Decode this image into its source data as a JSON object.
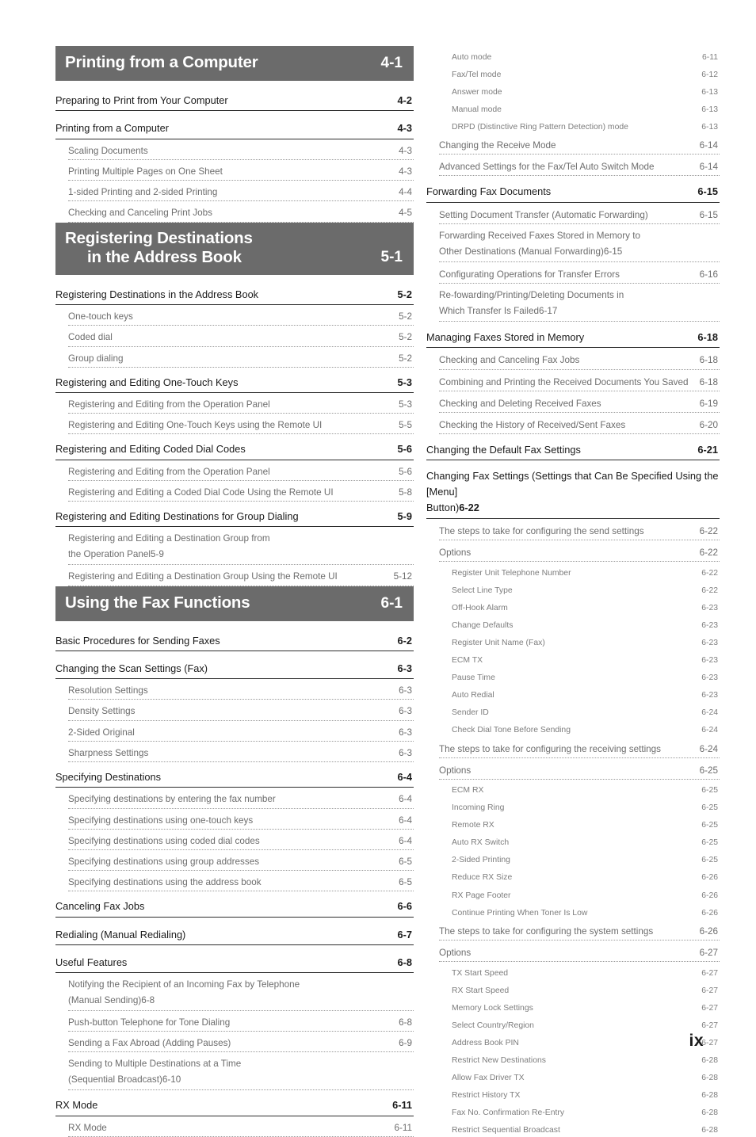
{
  "document": {
    "folio": "ix",
    "type": "table-of-contents"
  },
  "colors": {
    "chapter_bar_bg": "#6b6b6b",
    "chapter_bar_text": "#ffffff",
    "level1_text": "#1a1a1a",
    "level2_text": "#6d6d6d",
    "level3_text": "#7d7d7d",
    "level1_rule": "#2b2b2b",
    "level2_leader": "#9a9a9a"
  },
  "left_column": {
    "blocks": [
      {
        "kind": "chapter",
        "title_line1": "Printing from a Computer",
        "title_line2": "",
        "number": "4-1"
      },
      {
        "kind": "l1",
        "title": "Preparing to Print from Your Computer",
        "page": "4-2"
      },
      {
        "kind": "l1",
        "title": "Printing from a Computer",
        "page": "4-3"
      },
      {
        "kind": "l2",
        "title": "Scaling Documents",
        "page": "4-3"
      },
      {
        "kind": "l2",
        "title": "Printing Multiple Pages on One Sheet",
        "page": "4-3"
      },
      {
        "kind": "l2",
        "title": "1-sided Printing and 2-sided Printing",
        "page": "4-4"
      },
      {
        "kind": "l2",
        "title": "Checking and Canceling Print Jobs",
        "page": "4-5"
      },
      {
        "kind": "chapter",
        "title_line1": "Registering Destinations",
        "title_line2": "in the Address Book",
        "number": "5-1"
      },
      {
        "kind": "l1",
        "title": "Registering Destinations in the Address Book",
        "page": "5-2"
      },
      {
        "kind": "l2",
        "title": "One-touch keys",
        "page": "5-2"
      },
      {
        "kind": "l2",
        "title": "Coded dial",
        "page": "5-2"
      },
      {
        "kind": "l2",
        "title": "Group dialing",
        "page": "5-2"
      },
      {
        "kind": "l1",
        "title": "Registering and Editing One-Touch Keys",
        "page": "5-3"
      },
      {
        "kind": "l2",
        "title": "Registering and Editing from the Operation Panel",
        "page": "5-3"
      },
      {
        "kind": "l2",
        "title": "Registering and Editing One-Touch Keys using the Remote UI",
        "page": "5-5"
      },
      {
        "kind": "l1",
        "title": "Registering and Editing Coded Dial Codes",
        "page": "5-6"
      },
      {
        "kind": "l2",
        "title": "Registering and Editing from the Operation Panel",
        "page": "5-6"
      },
      {
        "kind": "l2",
        "title": "Registering and Editing a Coded Dial Code Using the Remote UI",
        "page": "5-8"
      },
      {
        "kind": "l1",
        "title": "Registering and Editing Destinations for Group Dialing",
        "page": "5-9"
      },
      {
        "kind": "l2w",
        "title_line1": "Registering and Editing a Destination Group from",
        "title_line2": "the Operation Panel",
        "page": "5-9"
      },
      {
        "kind": "l2",
        "title": "Registering and Editing a Destination Group Using the Remote UI",
        "page": "5-12"
      },
      {
        "kind": "chapter",
        "title_line1": "Using the Fax Functions",
        "title_line2": "",
        "number": "6-1"
      },
      {
        "kind": "l1",
        "title": "Basic Procedures for Sending Faxes",
        "page": "6-2"
      },
      {
        "kind": "l1",
        "title": "Changing the Scan Settings (Fax)",
        "page": "6-3"
      },
      {
        "kind": "l2",
        "title": "Resolution Settings",
        "page": "6-3"
      },
      {
        "kind": "l2",
        "title": "Density Settings",
        "page": "6-3"
      },
      {
        "kind": "l2",
        "title": "2-Sided Original",
        "page": "6-3"
      },
      {
        "kind": "l2",
        "title": "Sharpness Settings",
        "page": "6-3"
      },
      {
        "kind": "l1",
        "title": "Specifying Destinations",
        "page": "6-4"
      },
      {
        "kind": "l2",
        "title": "Specifying destinations by entering the fax number",
        "page": "6-4"
      },
      {
        "kind": "l2",
        "title": "Specifying destinations using one-touch keys",
        "page": "6-4"
      },
      {
        "kind": "l2",
        "title": "Specifying destinations using coded dial codes",
        "page": "6-4"
      },
      {
        "kind": "l2",
        "title": "Specifying destinations using group addresses",
        "page": "6-5"
      },
      {
        "kind": "l2",
        "title": "Specifying destinations using the address book",
        "page": "6-5"
      },
      {
        "kind": "l1",
        "title": "Canceling Fax Jobs",
        "page": "6-6"
      },
      {
        "kind": "l1",
        "title": "Redialing (Manual Redialing)",
        "page": "6-7"
      },
      {
        "kind": "l1",
        "title": "Useful Features",
        "page": "6-8"
      },
      {
        "kind": "l2w",
        "title_line1": "Notifying the Recipient of an Incoming Fax by Telephone",
        "title_line2": "(Manual Sending)",
        "page": "6-8"
      },
      {
        "kind": "l2",
        "title": "Push-button Telephone for Tone Dialing",
        "page": "6-8"
      },
      {
        "kind": "l2",
        "title": "Sending a Fax Abroad (Adding Pauses)",
        "page": "6-9"
      },
      {
        "kind": "l2w",
        "title_line1": "Sending to Multiple Destinations at a Time",
        "title_line2": "(Sequential Broadcast)",
        "page": "6-10"
      },
      {
        "kind": "l1",
        "title": "RX Mode",
        "page": "6-11"
      },
      {
        "kind": "l2",
        "title": "RX Mode",
        "page": "6-11"
      }
    ]
  },
  "right_column": {
    "blocks": [
      {
        "kind": "l3",
        "title": "Auto mode",
        "page": "6-11"
      },
      {
        "kind": "l3",
        "title": "Fax/Tel mode",
        "page": "6-12"
      },
      {
        "kind": "l3",
        "title": "Answer mode",
        "page": "6-13"
      },
      {
        "kind": "l3",
        "title": "Manual mode",
        "page": "6-13"
      },
      {
        "kind": "l3",
        "title": "DRPD (Distinctive Ring Pattern Detection) mode",
        "page": "6-13"
      },
      {
        "kind": "l2",
        "title": "Changing the Receive Mode",
        "page": "6-14"
      },
      {
        "kind": "l2",
        "title": "Advanced Settings for the Fax/Tel Auto Switch Mode",
        "page": "6-14"
      },
      {
        "kind": "l1",
        "title": "Forwarding Fax Documents",
        "page": "6-15"
      },
      {
        "kind": "l2",
        "title": "Setting Document Transfer (Automatic Forwarding)",
        "page": "6-15"
      },
      {
        "kind": "l2w",
        "title_line1": "Forwarding Received Faxes Stored in Memory to",
        "title_line2": "Other Destinations (Manual Forwarding)",
        "page": "6-15"
      },
      {
        "kind": "l2",
        "title": "Configurating Operations for Transfer Errors",
        "page": "6-16"
      },
      {
        "kind": "l2w",
        "title_line1": "Re-fowarding/Printing/Deleting Documents in",
        "title_line2": "Which Transfer Is Failed",
        "page": "6-17"
      },
      {
        "kind": "l1",
        "title": "Managing Faxes Stored in Memory",
        "page": "6-18"
      },
      {
        "kind": "l2",
        "title": "Checking and Canceling Fax Jobs",
        "page": "6-18"
      },
      {
        "kind": "l2",
        "title": "Combining and Printing the Received Documents You Saved",
        "page": "6-18"
      },
      {
        "kind": "l2",
        "title": "Checking and Deleting Received Faxes",
        "page": "6-19"
      },
      {
        "kind": "l2",
        "title": "Checking the History of Received/Sent Faxes",
        "page": "6-20"
      },
      {
        "kind": "l1",
        "title": "Changing the Default Fax Settings",
        "page": "6-21"
      },
      {
        "kind": "l1w",
        "title_line1": "Changing Fax Settings (Settings that Can Be Specified Using the [Menu]",
        "title_line2": "Button)",
        "page": "6-22"
      },
      {
        "kind": "l2",
        "title": "The steps to take for configuring the send settings",
        "page": "6-22"
      },
      {
        "kind": "l2",
        "title": "Options",
        "page": "6-22"
      },
      {
        "kind": "l3",
        "title": "Register Unit Telephone Number",
        "page": "6-22"
      },
      {
        "kind": "l3",
        "title": "Select Line Type",
        "page": "6-22"
      },
      {
        "kind": "l3",
        "title": "Off-Hook Alarm",
        "page": "6-23"
      },
      {
        "kind": "l3",
        "title": "Change Defaults",
        "page": "6-23"
      },
      {
        "kind": "l3",
        "title": "Register Unit Name (Fax)",
        "page": "6-23"
      },
      {
        "kind": "l3",
        "title": "ECM TX",
        "page": "6-23"
      },
      {
        "kind": "l3",
        "title": "Pause Time",
        "page": "6-23"
      },
      {
        "kind": "l3",
        "title": "Auto Redial",
        "page": "6-23"
      },
      {
        "kind": "l3",
        "title": "Sender ID",
        "page": "6-24"
      },
      {
        "kind": "l3",
        "title": "Check Dial Tone Before Sending",
        "page": "6-24"
      },
      {
        "kind": "l2",
        "title": "The steps to take for configuring the receiving settings",
        "page": "6-24"
      },
      {
        "kind": "l2",
        "title": "Options",
        "page": "6-25"
      },
      {
        "kind": "l3",
        "title": "ECM RX",
        "page": "6-25"
      },
      {
        "kind": "l3",
        "title": "Incoming Ring",
        "page": "6-25"
      },
      {
        "kind": "l3",
        "title": "Remote RX",
        "page": "6-25"
      },
      {
        "kind": "l3",
        "title": "Auto RX Switch",
        "page": "6-25"
      },
      {
        "kind": "l3",
        "title": "2-Sided Printing",
        "page": "6-25"
      },
      {
        "kind": "l3",
        "title": "Reduce RX Size",
        "page": "6-26"
      },
      {
        "kind": "l3",
        "title": "RX Page Footer",
        "page": "6-26"
      },
      {
        "kind": "l3",
        "title": "Continue Printing When Toner Is Low",
        "page": "6-26"
      },
      {
        "kind": "l2",
        "title": "The steps to take for configuring the system settings",
        "page": "6-26"
      },
      {
        "kind": "l2",
        "title": "Options",
        "page": "6-27"
      },
      {
        "kind": "l3",
        "title": "TX Start Speed",
        "page": "6-27"
      },
      {
        "kind": "l3",
        "title": "RX Start Speed",
        "page": "6-27"
      },
      {
        "kind": "l3",
        "title": "Memory Lock Settings",
        "page": "6-27"
      },
      {
        "kind": "l3",
        "title": "Select Country/Region",
        "page": "6-27"
      },
      {
        "kind": "l3",
        "title": "Address Book PIN",
        "page": "6-27"
      },
      {
        "kind": "l3",
        "title": "Restrict New Destinations",
        "page": "6-28"
      },
      {
        "kind": "l3",
        "title": "Allow Fax Driver TX",
        "page": "6-28"
      },
      {
        "kind": "l3",
        "title": "Restrict History TX",
        "page": "6-28"
      },
      {
        "kind": "l3",
        "title": "Fax No. Confirmation Re-Entry",
        "page": "6-28"
      },
      {
        "kind": "l3",
        "title": "Restrict Sequential Broadcast",
        "page": "6-28"
      }
    ]
  }
}
